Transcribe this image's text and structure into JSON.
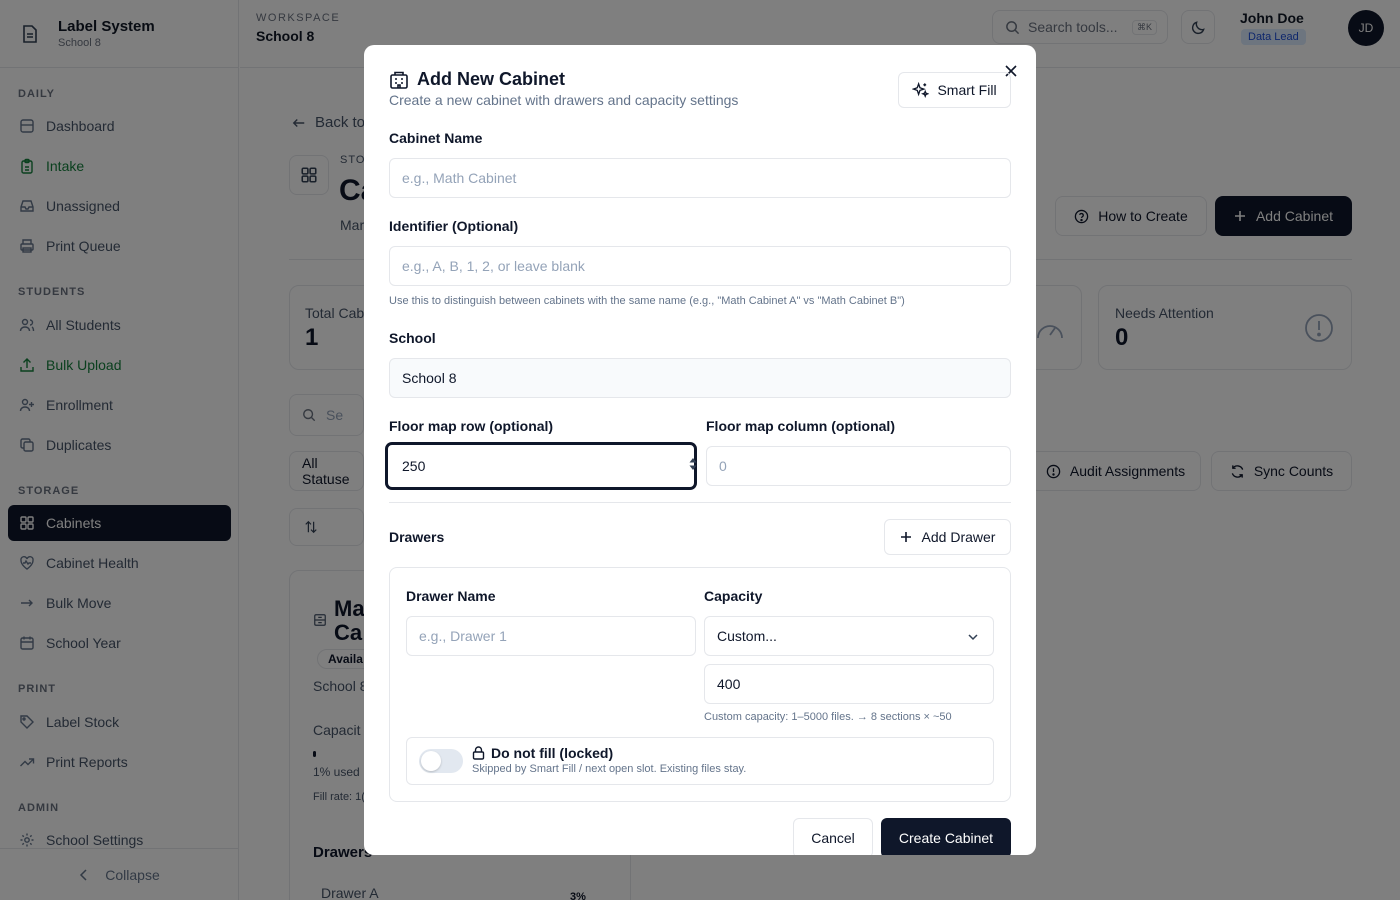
{
  "app": {
    "title": "Label System",
    "subtitle": "School 8"
  },
  "sidebar": {
    "sections": [
      {
        "label": "DAILY",
        "items": [
          "Dashboard",
          "Intake",
          "Unassigned",
          "Print Queue"
        ]
      },
      {
        "label": "STUDENTS",
        "items": [
          "All Students",
          "Bulk Upload",
          "Enrollment",
          "Duplicates"
        ]
      },
      {
        "label": "STORAGE",
        "items": [
          "Cabinets",
          "Cabinet Health",
          "Bulk Move",
          "School Year"
        ]
      },
      {
        "label": "PRINT",
        "items": [
          "Label Stock",
          "Print Reports"
        ]
      },
      {
        "label": "ADMIN",
        "items": [
          "School Settings"
        ]
      }
    ],
    "collapse_label": "Collapse"
  },
  "header": {
    "workspace_label": "WORKSPACE",
    "workspace_name": "School 8",
    "search_placeholder": "Search tools...",
    "search_shortcut": "⌘K",
    "user_name": "John Doe",
    "user_role": "Data Lead",
    "avatar_initials": "JD"
  },
  "background": {
    "back_link": "Back to",
    "page_label": "STO",
    "page_title": "Ca",
    "page_desc": "Mar",
    "how_to_create": "How to Create",
    "add_cabinet": "Add Cabinet",
    "stat_total_label": "Total Cab",
    "stat_total_value": "1",
    "stat_attention_label": "Needs Attention",
    "stat_attention_value": "0",
    "search_placeholder": "Se",
    "status_filter": "All Statuse",
    "audit_assignments": "Audit Assignments",
    "sync_counts": "Sync Counts",
    "card_title_1": "Ma",
    "card_title_2": "Ca",
    "card_badge": "Availa",
    "card_school": "School 8",
    "card_capacity": "Capacit",
    "card_used": "1% used",
    "card_fill_rate": "Fill rate: 1(",
    "drawers_label": "Drawers",
    "drawer_a": "Drawer A",
    "drawer_pct": "3%"
  },
  "modal": {
    "title": "Add New Cabinet",
    "description": "Create a new cabinet with drawers and capacity settings",
    "smart_fill": "Smart Fill",
    "cabinet_name_label": "Cabinet Name",
    "cabinet_name_placeholder": "e.g., Math Cabinet",
    "identifier_label": "Identifier (Optional)",
    "identifier_placeholder": "e.g., A, B, 1, 2, or leave blank",
    "identifier_hint": "Use this to distinguish between cabinets with the same name (e.g., \"Math Cabinet A\" vs \"Math Cabinet B\")",
    "school_label": "School",
    "school_value": "School 8",
    "floor_row_label": "Floor map row (optional)",
    "floor_row_value": "250",
    "floor_col_label": "Floor map column (optional)",
    "floor_col_placeholder": "0",
    "drawers_label": "Drawers",
    "add_drawer": "Add Drawer",
    "drawer": {
      "name_label": "Drawer Name",
      "name_placeholder": "e.g., Drawer 1",
      "capacity_label": "Capacity",
      "capacity_select": "Custom...",
      "capacity_value": "400",
      "capacity_hint": "Custom capacity: 1–5000 files. → 8 sections × ~50",
      "lock_title": "Do not fill (locked)",
      "lock_sub": "Skipped by Smart Fill / next open slot. Existing files stay."
    },
    "cancel": "Cancel",
    "create": "Create Cabinet"
  },
  "colors": {
    "primary": "#0f172a",
    "border": "#e5e7eb",
    "muted": "#64748b",
    "green": "#15803d",
    "badge_bg": "#dbeafe"
  }
}
